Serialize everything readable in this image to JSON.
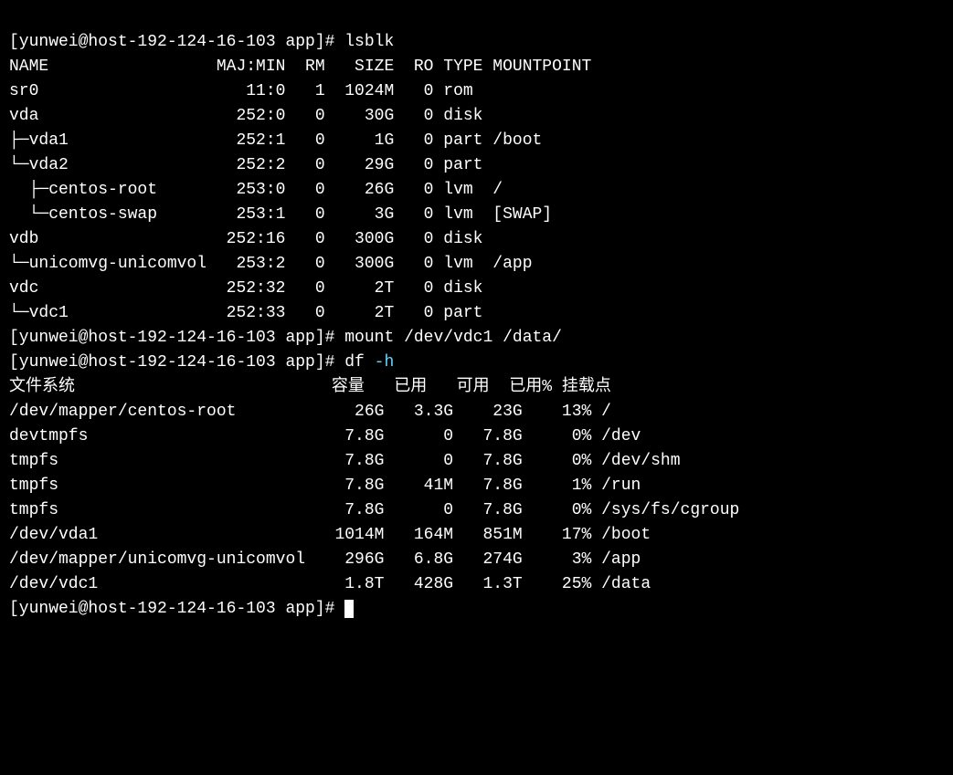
{
  "prompts": {
    "p1": "[yunwei@host-192-124-16-103 app]# ",
    "p2": "[yunwei@host-192-124-16-103 app]# ",
    "p3": "[yunwei@host-192-124-16-103 app]# ",
    "p4": "[yunwei@host-192-124-16-103 app]# "
  },
  "commands": {
    "c1": "lsblk",
    "c2": "mount /dev/vdc1 /data/",
    "c3_cmd": "df ",
    "c3_opt": "-h"
  },
  "lsblk": {
    "header": {
      "name": "NAME",
      "majmin": "MAJ:MIN",
      "rm": "RM",
      "size": "SIZE",
      "ro": "RO",
      "type": "TYPE",
      "mount": "MOUNTPOINT"
    },
    "rows": [
      {
        "prefix": "",
        "name": "sr0",
        "majmin": "11:0",
        "rm": "1",
        "size": "1024M",
        "ro": "0",
        "type": "rom",
        "mount": ""
      },
      {
        "prefix": "",
        "name": "vda",
        "majmin": "252:0",
        "rm": "0",
        "size": "30G",
        "ro": "0",
        "type": "disk",
        "mount": ""
      },
      {
        "prefix": "├─",
        "name": "vda1",
        "majmin": "252:1",
        "rm": "0",
        "size": "1G",
        "ro": "0",
        "type": "part",
        "mount": "/boot"
      },
      {
        "prefix": "└─",
        "name": "vda2",
        "majmin": "252:2",
        "rm": "0",
        "size": "29G",
        "ro": "0",
        "type": "part",
        "mount": ""
      },
      {
        "prefix": "  ├─",
        "name": "centos-root",
        "majmin": "253:0",
        "rm": "0",
        "size": "26G",
        "ro": "0",
        "type": "lvm",
        "mount": "/"
      },
      {
        "prefix": "  └─",
        "name": "centos-swap",
        "majmin": "253:1",
        "rm": "0",
        "size": "3G",
        "ro": "0",
        "type": "lvm",
        "mount": "[SWAP]"
      },
      {
        "prefix": "",
        "name": "vdb",
        "majmin": "252:16",
        "rm": "0",
        "size": "300G",
        "ro": "0",
        "type": "disk",
        "mount": ""
      },
      {
        "prefix": "└─",
        "name": "unicomvg-unicomvol",
        "majmin": "253:2",
        "rm": "0",
        "size": "300G",
        "ro": "0",
        "type": "lvm",
        "mount": "/app"
      },
      {
        "prefix": "",
        "name": "vdc",
        "majmin": "252:32",
        "rm": "0",
        "size": "2T",
        "ro": "0",
        "type": "disk",
        "mount": ""
      },
      {
        "prefix": "└─",
        "name": "vdc1",
        "majmin": "252:33",
        "rm": "0",
        "size": "2T",
        "ro": "0",
        "type": "part",
        "mount": ""
      }
    ]
  },
  "df": {
    "header": {
      "fs": "文件系统",
      "size": "容量",
      "used": "已用",
      "avail": "可用",
      "usep": "已用%",
      "mount": "挂载点"
    },
    "rows": [
      {
        "fs": "/dev/mapper/centos-root",
        "size": "26G",
        "used": "3.3G",
        "avail": "23G",
        "usep": "13%",
        "mount": "/"
      },
      {
        "fs": "devtmpfs",
        "size": "7.8G",
        "used": "0",
        "avail": "7.8G",
        "usep": "0%",
        "mount": "/dev"
      },
      {
        "fs": "tmpfs",
        "size": "7.8G",
        "used": "0",
        "avail": "7.8G",
        "usep": "0%",
        "mount": "/dev/shm"
      },
      {
        "fs": "tmpfs",
        "size": "7.8G",
        "used": "41M",
        "avail": "7.8G",
        "usep": "1%",
        "mount": "/run"
      },
      {
        "fs": "tmpfs",
        "size": "7.8G",
        "used": "0",
        "avail": "7.8G",
        "usep": "0%",
        "mount": "/sys/fs/cgroup"
      },
      {
        "fs": "/dev/vda1",
        "size": "1014M",
        "used": "164M",
        "avail": "851M",
        "usep": "17%",
        "mount": "/boot"
      },
      {
        "fs": "/dev/mapper/unicomvg-unicomvol",
        "size": "296G",
        "used": "6.8G",
        "avail": "274G",
        "usep": "3%",
        "mount": "/app"
      },
      {
        "fs": "/dev/vdc1",
        "size": "1.8T",
        "used": "428G",
        "avail": "1.3T",
        "usep": "25%",
        "mount": "/data"
      }
    ]
  }
}
